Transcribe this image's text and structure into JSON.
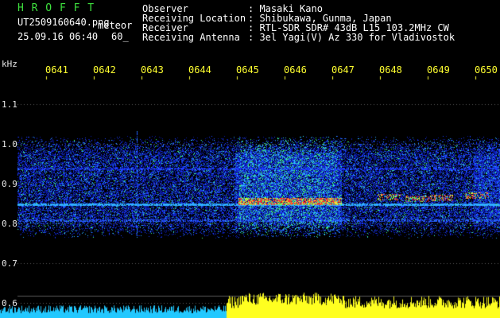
{
  "header": {
    "app_title": "H R O F F T",
    "filename": "UT2509160640.png",
    "meteor_label": "meteor",
    "datetime": "25.09.16 06:40",
    "count": "60_"
  },
  "info": {
    "rows": [
      {
        "label": "Observer",
        "value": ": Masaki Kano"
      },
      {
        "label": "Receiving Location",
        "value": ": Shibukawa, Gunma, Japan"
      },
      {
        "label": "Receiver",
        "value": ": RTL-SDR SDR# 43dB L15 103.2MHz CW"
      },
      {
        "label": "Receiving Antenna",
        "value": ": 3el Yagi(V) Az 330 for Vladivostok"
      }
    ]
  },
  "axis": {
    "unit": "kHz",
    "time_ticks": [
      "0641",
      "0642",
      "0643",
      "0644",
      "0645",
      "0646",
      "0647",
      "0648",
      "0649",
      "0650"
    ],
    "freq_labels": [
      "1.1",
      "1.0",
      "0.9",
      "0.8",
      "0.7",
      "0.6"
    ]
  },
  "colors": {
    "title": "#3ee03e",
    "tick": "#ffff30",
    "band": "#2a3cff",
    "hot": "#ff2a2a",
    "bar_cyan": "#22c8ff",
    "bar_yellow": "#ffff20"
  }
}
